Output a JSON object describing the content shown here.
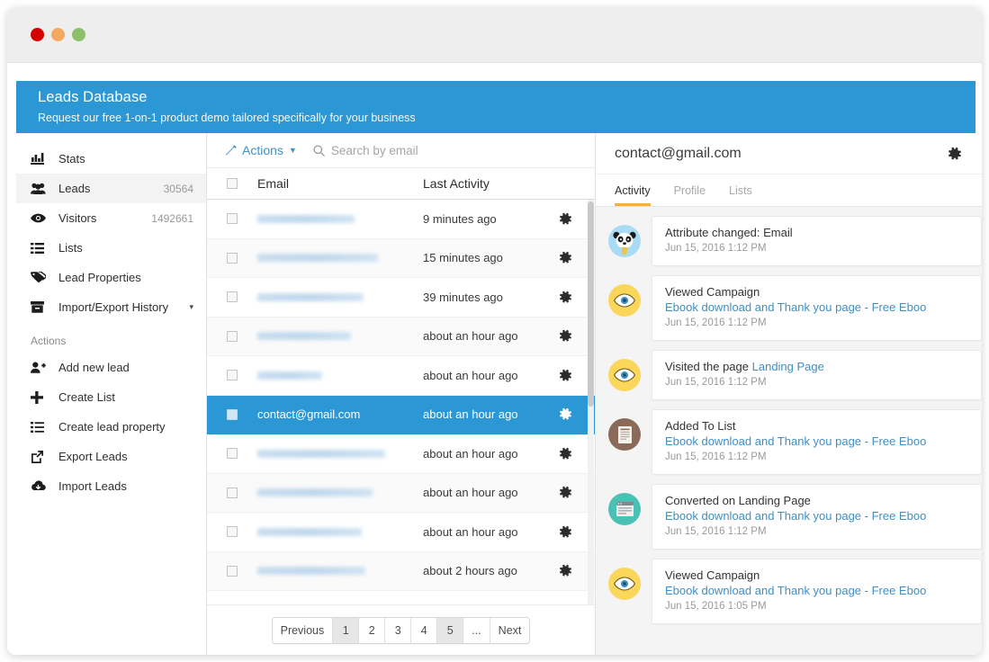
{
  "window": {
    "traffic_lights": [
      "close",
      "minimize",
      "maximize"
    ]
  },
  "header": {
    "title": "Leads Database",
    "subtitle": "Request our free 1-on-1 product demo tailored specifically for your business",
    "accent_color": "#2b97d4"
  },
  "sidebar": {
    "items": [
      {
        "label": "Stats",
        "count": "",
        "icon": "bar-chart-icon",
        "active": false,
        "caret": false
      },
      {
        "label": "Leads",
        "count": "30564",
        "icon": "users-icon",
        "active": true,
        "caret": false
      },
      {
        "label": "Visitors",
        "count": "1492661",
        "icon": "eye-icon",
        "active": false,
        "caret": false
      },
      {
        "label": "Lists",
        "count": "",
        "icon": "list-icon",
        "active": false,
        "caret": false
      },
      {
        "label": "Lead Properties",
        "count": "",
        "icon": "tag-icon",
        "active": false,
        "caret": false
      },
      {
        "label": "Import/Export History",
        "count": "",
        "icon": "archive-icon",
        "active": false,
        "caret": true
      }
    ],
    "section_title": "Actions",
    "actions": [
      {
        "label": "Add new lead",
        "icon": "user-plus-icon"
      },
      {
        "label": "Create List",
        "icon": "plus-icon"
      },
      {
        "label": "Create lead property",
        "icon": "list-ul-icon"
      },
      {
        "label": "Export Leads",
        "icon": "external-link-icon"
      },
      {
        "label": "Import Leads",
        "icon": "cloud-download-icon"
      }
    ]
  },
  "table": {
    "actions_label": "Actions",
    "actions_icon": "magic-wand-icon",
    "search_icon": "search-icon",
    "search_placeholder": "Search by email",
    "search_value": "",
    "columns": {
      "email": "Email",
      "activity": "Last Activity"
    },
    "header_checkbox_checked": false,
    "row_gear_icon": "gear-icon",
    "rows": [
      {
        "email": "",
        "masked": true,
        "mask_width": 108,
        "activity": "9 minutes ago",
        "selected": false
      },
      {
        "email": "",
        "masked": true,
        "mask_width": 134,
        "activity": "15 minutes ago",
        "selected": false
      },
      {
        "email": "",
        "masked": true,
        "mask_width": 118,
        "activity": "39 minutes ago",
        "selected": false
      },
      {
        "email": "",
        "masked": true,
        "mask_width": 104,
        "activity": "about an hour ago",
        "selected": false
      },
      {
        "email": "",
        "masked": true,
        "mask_width": 72,
        "activity": "about an hour ago",
        "selected": false
      },
      {
        "email": "contact@gmail.com",
        "masked": false,
        "mask_width": 0,
        "activity": "about an hour ago",
        "selected": true
      },
      {
        "email": "",
        "masked": true,
        "mask_width": 142,
        "activity": "about an hour ago",
        "selected": false
      },
      {
        "email": "",
        "masked": true,
        "mask_width": 128,
        "activity": "about an hour ago",
        "selected": false
      },
      {
        "email": "",
        "masked": true,
        "mask_width": 116,
        "activity": "about an hour ago",
        "selected": false
      },
      {
        "email": "",
        "masked": true,
        "mask_width": 120,
        "activity": "about 2 hours ago",
        "selected": false
      }
    ],
    "pagination": {
      "previous_label": "Previous",
      "next_label": "Next",
      "pages": [
        "1",
        "2",
        "3",
        "4",
        "5",
        "..."
      ],
      "current_page": "1"
    }
  },
  "detail": {
    "email": "contact@gmail.com",
    "settings_icon": "gear-icon",
    "tabs": [
      {
        "label": "Activity",
        "active": true
      },
      {
        "label": "Profile",
        "active": false
      },
      {
        "label": "Lists",
        "active": false
      }
    ],
    "activity": [
      {
        "icon": "panda-avatar-icon",
        "avatar_class": "av-panda",
        "title": "Attribute changed: Email",
        "link": "",
        "time": "Jun 15, 2016 1:12 PM"
      },
      {
        "icon": "eye-icon",
        "avatar_class": "av-eye",
        "title": "Viewed Campaign",
        "link": "Ebook download and Thank you page - Free Eboo",
        "time": "Jun 15, 2016 1:12 PM"
      },
      {
        "icon": "eye-icon",
        "avatar_class": "av-eye",
        "title": "Visited the page ",
        "inline_link": "Landing Page",
        "link": "",
        "time": "Jun 15, 2016 1:12 PM"
      },
      {
        "icon": "document-icon",
        "avatar_class": "av-doc",
        "title": "Added To List",
        "link": "Ebook download and Thank you page - Free Eboo",
        "time": "Jun 15, 2016 1:12 PM"
      },
      {
        "icon": "browser-window-icon",
        "avatar_class": "av-page",
        "title": "Converted on Landing Page",
        "link": "Ebook download and Thank you page - Free Eboo",
        "time": "Jun 15, 2016 1:12 PM"
      },
      {
        "icon": "eye-icon",
        "avatar_class": "av-eye",
        "title": "Viewed Campaign",
        "link": "Ebook download and Thank you page - Free Eboo",
        "time": "Jun 15, 2016 1:05 PM"
      }
    ]
  }
}
